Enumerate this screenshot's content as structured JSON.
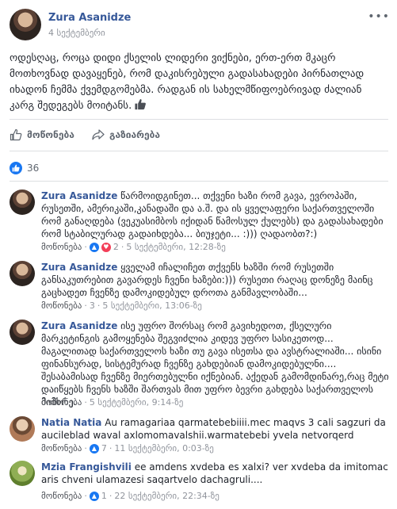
{
  "post": {
    "author": "Zura Asanidze",
    "date": "4 სექტემბერი",
    "text": "ოდესღაც, როცა დიდი ქსელის ლიდერი ვიქნები, ერთ-ერთ მკაცრ მოთხოვნად დავაყენებ, რომ დაკისრებული გადასახადები პირნათლად იხადონ ჩემმა ქვემდგომებმა. რადგან ის სახელმწიფოებრივად ძალიან კარგ შედეგებს მოიტანს."
  },
  "actions": {
    "like_label": "მოწონება",
    "share_label": "გაზიარება"
  },
  "reactions": {
    "count": "36"
  },
  "comments": [
    {
      "author": "Zura Asanidze",
      "text": "წარმოიდგინეთ... თქვენი ხაზი რომ გავა, ევროპაში, რუსეთში, ამერიკაში,კანადაში და ა.შ. და ის ყველაფერი საქართველოში რომ განაღდება (ვეკუასიმბოს იქიდან წამოსულ ქულებს) და გადასახადები რომ სტაბილურად გადაიხდება... ბიუჯეტი... :))) ღადაობთ?:)",
      "like": "მოწონება",
      "sep": "·",
      "reactions": "2",
      "replies": "5 სექტემბერი, 12:28-ზე"
    },
    {
      "author": "Zura Asanidze",
      "text": "ყველამ იჩალიჩეთ თქვენს ხაზში რომ რუსეთში განსაკუთრებით გავარდეს ჩვენი ხაზები:))) რუსეთი რაღაც დონეზე მაინც გაცხადეთ ჩვენზე დამოკიდებულ დროთა განმავლობაში...",
      "like": "მოწონება",
      "sep": "·",
      "reactions": "3",
      "replies": "5 სექტემბერი, 13:06-ზე"
    },
    {
      "author": "Zura Asanidze",
      "text": "ისე უფრო შორსაც რომ გავიხედოთ, ქსელური მარკეტინგის გამოყენება შეგვიძლია კიდევ უფრო სასიკეთოდ... მაგალითად საქართველოს ხაზი თუ გავა ისეთსა და ავსტრალიაში... ისინი ფინანსურად, სისტემურად ჩვენზე გახდებიან დამოკიდებულნი.... შესაბამისად ჩვენზე მიერთებულნი იქნებიან. აქედან გამომდინარე,რაც მეტი დაიწყებს ჩვენს ხაზში შართვას მით უფრო ბევრი გახდება საქართველოს მიმხრე.",
      "like": "მოწონება",
      "sep": "·",
      "reactions": "",
      "replies": "5 სექტემბერი, 9:14-ზე"
    },
    {
      "author": "Natia Natia",
      "text": "Au ramagariaa qarmatebebiiii.mec maqvs 3 cali sagzuri da aucileblad waval axlomomavalshii.warmatebebi yvela netvorqerd",
      "like": "მოწონება",
      "sep": "·",
      "reactions": "7",
      "replies": "11 სექტემბერი, 0:03-ზე"
    },
    {
      "author": "Mzia Frangishvili",
      "text": "ee amdens xvdeba es xalxi? ver xvdeba da imitomac aris chveni ulamazesi saqartvelo dachagruli....",
      "like": "მოწონება",
      "sep": "·",
      "reactions": "1",
      "replies": "22 სექტემბერი, 22:34-ზე"
    }
  ],
  "colors": {
    "link": "#365899",
    "accent": "#1877f2",
    "meta": "#90949c"
  }
}
